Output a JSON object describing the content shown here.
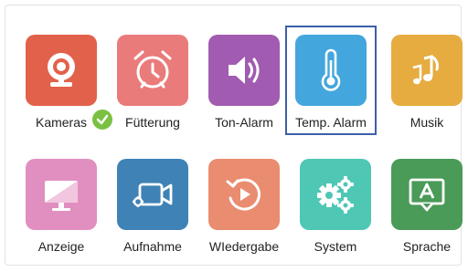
{
  "tiles": [
    {
      "label": "Kameras",
      "icon": "camera-icon",
      "color": "#e2614a",
      "badge": "check-icon"
    },
    {
      "label": "Fütterung",
      "icon": "alarm-clock-icon",
      "color": "#ea7b7b"
    },
    {
      "label": "Ton-Alarm",
      "icon": "speaker-icon",
      "color": "#a15bb0"
    },
    {
      "label": "Temp. Alarm",
      "icon": "thermometer-icon",
      "color": "#43a6dc",
      "selected": true
    },
    {
      "label": "Musik",
      "icon": "music-note-icon",
      "color": "#e6ac3f"
    },
    {
      "label": "Anzeige",
      "icon": "monitor-icon",
      "color": "#e08fc0"
    },
    {
      "label": "Aufnahme",
      "icon": "video-record-icon",
      "color": "#3f82b5"
    },
    {
      "label": "WIedergabe",
      "icon": "replay-icon",
      "color": "#e98c6f"
    },
    {
      "label": "System",
      "icon": "gears-icon",
      "color": "#4ec7b4"
    },
    {
      "label": "Sprache",
      "icon": "language-icon",
      "color": "#4a9a58"
    }
  ]
}
